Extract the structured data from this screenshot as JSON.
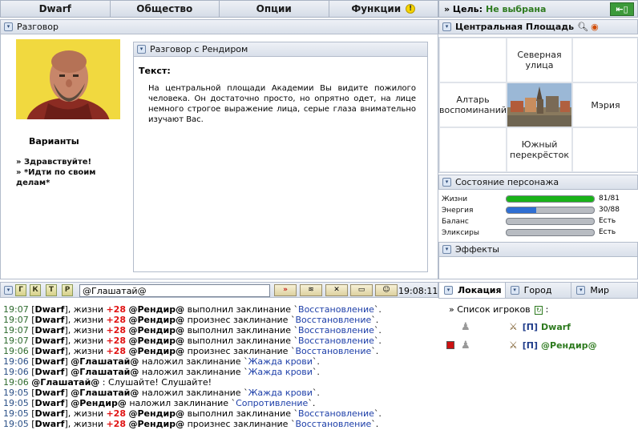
{
  "menu": [
    "Dwarf",
    "Общество",
    "Опции",
    "Функции"
  ],
  "goal": {
    "label": "» Цель:",
    "value": "Не выбрана"
  },
  "conversation": {
    "header": "Разговор",
    "dialog_header": "Разговор с Рендиром",
    "text_label": "Текст:",
    "text": "На центральной площади Академии Вы видите пожилого человека. Он достаточно просто, но опрятно одет, на лице немного строгое выражение лица, серые глаза внимательно изучают Вас.",
    "variants_title": "Варианты",
    "variants": [
      "» Здравствуйте!",
      "» *Идти по своим делам*"
    ]
  },
  "location": {
    "header": "Центральная Площадь",
    "north": "Северная улица",
    "west": "Алтарь воспоминаний",
    "east": "Мэрия",
    "south": "Южный перекрёсток"
  },
  "status": {
    "header": "Состояние персонажа",
    "items": [
      {
        "name": "Жизни",
        "value": "81/81",
        "fraction": 1.0,
        "color": "#19b319"
      },
      {
        "name": "Энергия",
        "value": "30/88",
        "fraction": 0.34,
        "color": "#2f6fd3"
      },
      {
        "name": "Баланс",
        "value": "Есть",
        "fraction": 0,
        "color": "#19b319"
      },
      {
        "name": "Эликсиры",
        "value": "Есть",
        "fraction": 0,
        "color": "#19b319"
      }
    ]
  },
  "effects": {
    "header": "Эффекты"
  },
  "chat": {
    "channels": [
      "Г",
      "К",
      "Т",
      "Р"
    ],
    "input": "@Глашатай@",
    "time": "19:08:11"
  },
  "log": [
    {
      "time": "19:07",
      "who": "Dwarf",
      "hp": "+28",
      "actor": "@Рендир@",
      "verb": "выполнил заклинание",
      "spell": "Восстановление"
    },
    {
      "time": "19:07",
      "who": "Dwarf",
      "hp": "+28",
      "actor": "@Рендир@",
      "verb": "произнес заклинание",
      "spell": "Восстановление"
    },
    {
      "time": "19:07",
      "who": "Dwarf",
      "hp": "+28",
      "actor": "@Рендир@",
      "verb": "выполнил заклинание",
      "spell": "Восстановление"
    },
    {
      "time": "19:07",
      "who": "Dwarf",
      "hp": "+28",
      "actor": "@Рендир@",
      "verb": "выполнил заклинание",
      "spell": "Восстановление"
    },
    {
      "time": "19:06",
      "who": "Dwarf",
      "hp": "+28",
      "actor": "@Рендир@",
      "verb": "произнес заклинание",
      "spell": "Восстановление"
    },
    {
      "time": "19:06",
      "who": "Dwarf",
      "hp": "",
      "actor": "@Глашатай@",
      "verb": "наложил заклинание",
      "spell": "Жажда крови"
    },
    {
      "time": "19:06",
      "who": "Dwarf",
      "hp": "",
      "actor": "@Глашатай@",
      "verb": "наложил заклинание",
      "spell": "Жажда крови"
    },
    {
      "time": "19:06",
      "who": "",
      "hp": "",
      "actor": "@Глашатай@",
      "verb": ": Слушайте! Слушайте!",
      "spell": ""
    },
    {
      "time": "19:05",
      "who": "Dwarf",
      "hp": "",
      "actor": "@Глашатай@",
      "verb": "наложил заклинание",
      "spell": "Жажда крови"
    },
    {
      "time": "19:05",
      "who": "Dwarf",
      "hp": "",
      "actor": "@Рендир@",
      "verb": "наложил заклинание",
      "spell": "Сопротивление"
    },
    {
      "time": "19:05",
      "who": "Dwarf",
      "hp": "+28",
      "actor": "@Рендир@",
      "verb": "выполнил заклинание",
      "spell": "Восстановление"
    },
    {
      "time": "19:05",
      "who": "Dwarf",
      "hp": "+28",
      "actor": "@Рендир@",
      "verb": "произнес заклинание",
      "spell": "Восстановление"
    }
  ],
  "tabs": [
    "Локация",
    "Город",
    "Мир"
  ],
  "players": {
    "title": "» Список игроков",
    "title_suffix": ":",
    "list": [
      {
        "clan": "[П]",
        "name": "Dwarf",
        "flag": ""
      },
      {
        "clan": "[П]",
        "name": "@Рендир@",
        "flag": "#cc1111"
      }
    ]
  }
}
